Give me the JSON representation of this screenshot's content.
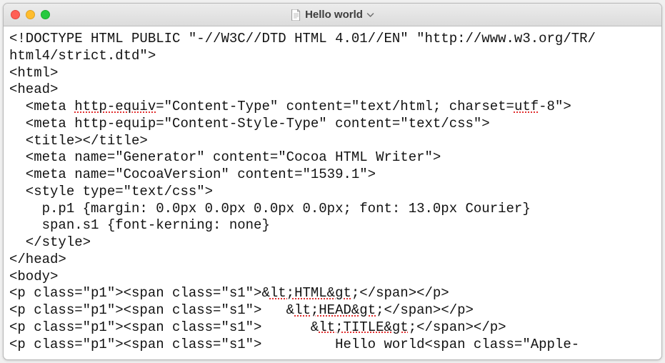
{
  "window": {
    "title": "Hello world",
    "icon": "document-icon",
    "dropdown": true
  },
  "trafficLights": {
    "close": "red",
    "minimize": "yellow",
    "zoom": "green"
  },
  "code": {
    "line1_a": "<!DOCTYPE HTML PUBLIC \"-//W3C//DTD HTML 4.01//EN\" \"http://www.w3.org/TR/",
    "line2": "html4/strict.dtd\">",
    "line3": "<html>",
    "line4": "<head>",
    "line5_a": "  <meta ",
    "line5_sp1": "http-equiv",
    "line5_b": "=\"Content-Type\" content=\"text/html; charset=",
    "line5_sp2": "utf",
    "line5_c": "-8\">",
    "line6": "  <meta http-equip=\"Content-Style-Type\" content=\"text/css\">",
    "line7": "  <title></title>",
    "line8": "  <meta name=\"Generator\" content=\"Cocoa HTML Writer\">",
    "line9": "  <meta name=\"CocoaVersion\" content=\"1539.1\">",
    "line10": "  <style type=\"text/css\">",
    "line11": "    p.p1 {margin: 0.0px 0.0px 0.0px 0.0px; font: 13.0px Courier}",
    "line12": "    span.s1 {font-kerning: none}",
    "line13": "  </style>",
    "line14": "</head>",
    "line15": "<body>",
    "line16_a": "<p class=\"p1\"><span class=\"s1\">&",
    "line16_sp1": "lt;HTML&gt",
    "line16_b": ";</span></p>",
    "line17_a": "<p class=\"p1\"><span class=\"s1\">   &",
    "line17_sp1": "lt;HEAD&gt",
    "line17_b": ";</span></p>",
    "line18_a": "<p class=\"p1\"><span class=\"s1\">      &",
    "line18_sp1": "lt;TITLE&gt",
    "line18_b": ";</span></p>",
    "line19": "<p class=\"p1\"><span class=\"s1\">         Hello world<span class=\"Apple-"
  }
}
